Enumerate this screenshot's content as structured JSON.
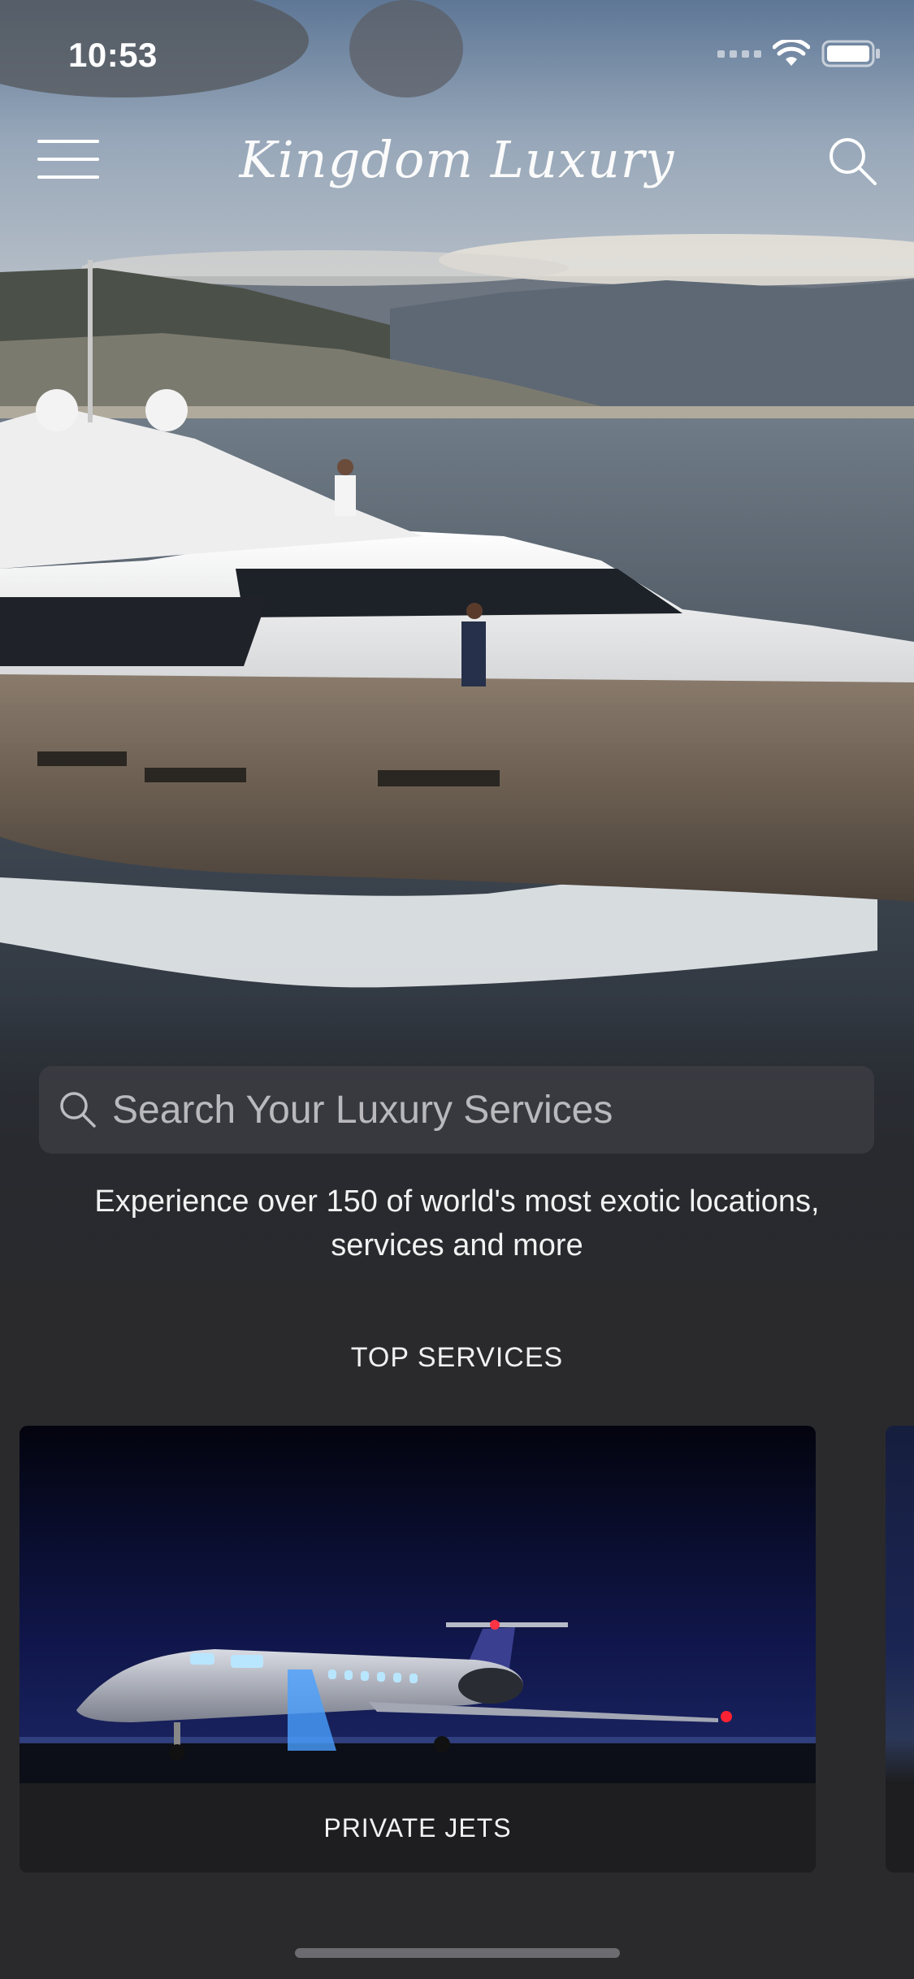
{
  "status_bar": {
    "time": "10:53"
  },
  "header": {
    "brand": "Kingdom Luxury"
  },
  "hero": {
    "search_placeholder": "Search Your Luxury Services",
    "tagline": "Experience over 150 of world's most exotic locations, services and more"
  },
  "top_services": {
    "title": "TOP SERVICES",
    "cards": [
      {
        "label": "PRIVATE JETS"
      }
    ]
  },
  "icons": {
    "menu": "hamburger-icon",
    "search": "search-icon",
    "wifi": "wifi-icon",
    "battery": "battery-icon",
    "signal": "signal-icon"
  }
}
